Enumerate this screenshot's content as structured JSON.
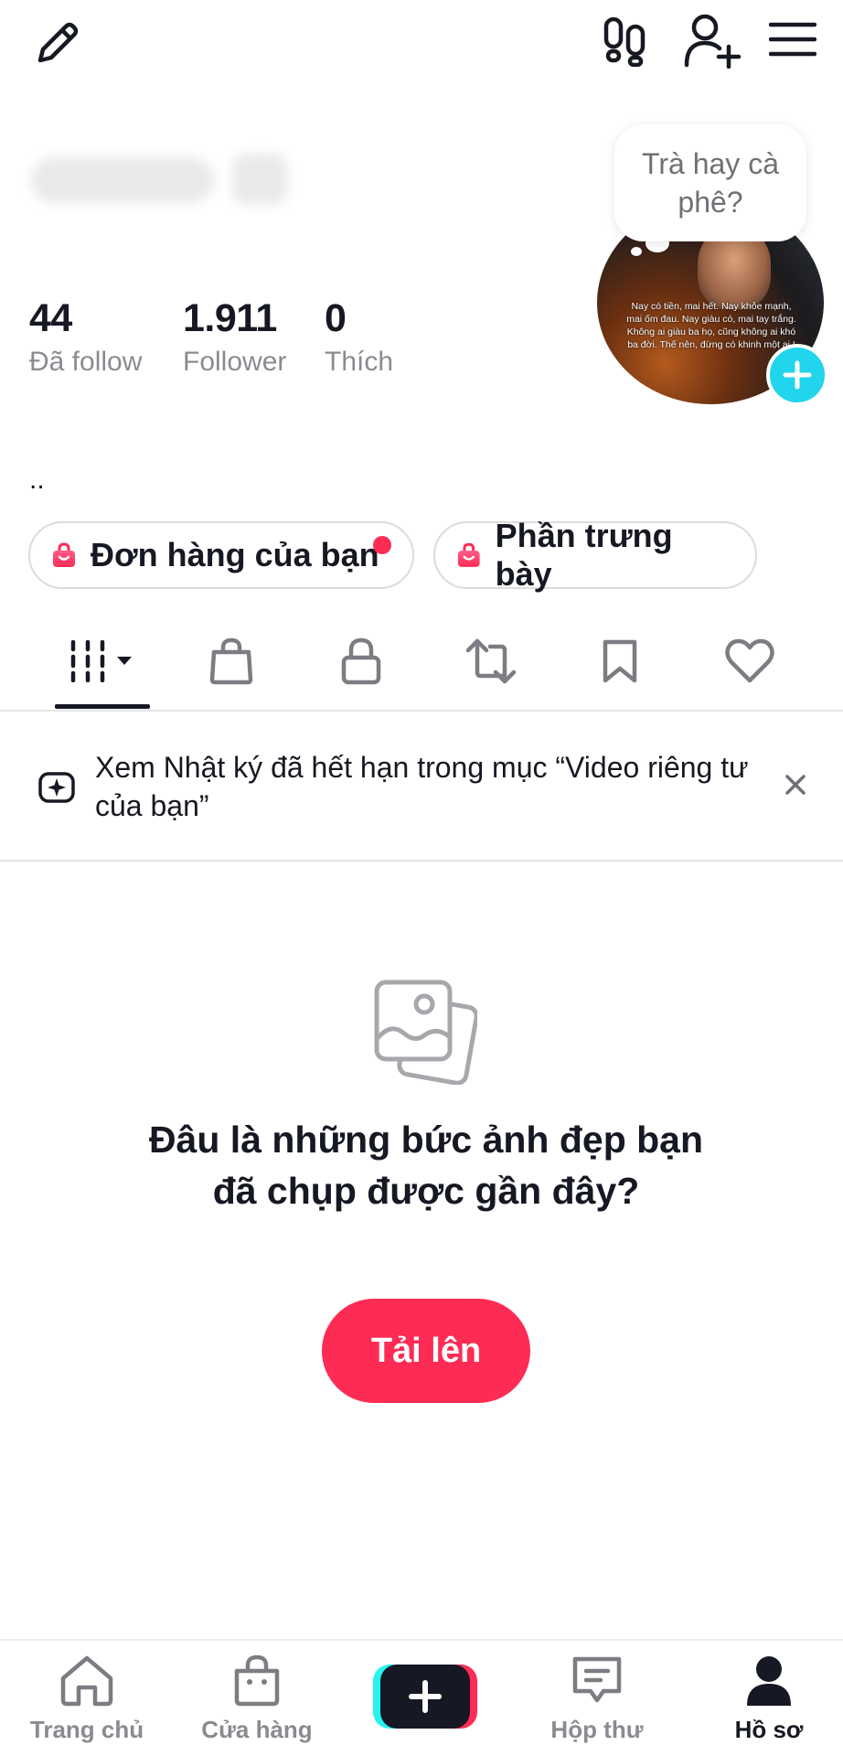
{
  "icons": {
    "edit": "pencil-icon",
    "footprints": "footprints-icon",
    "add_user": "add-user-icon",
    "menu": "hamburger-menu-icon"
  },
  "profile": {
    "bubble_text": "Trà hay cà phê?",
    "avatar_caption": "Nay có tiền, mai hết. Nay khỏe mạnh, mai ốm đau. Nay giàu có, mai tay trắng. Không ai giàu ba họ, cũng không ai khó ba đời. Thế nên, đừng có khinh một ai !",
    "bio": ".."
  },
  "stats": {
    "following": {
      "value": "44",
      "label": "Đã follow"
    },
    "followers": {
      "value": "1.911",
      "label": "Follower"
    },
    "likes": {
      "value": "0",
      "label": "Thích"
    }
  },
  "pills": {
    "orders": {
      "label": "Đơn hàng của bạn",
      "has_notification": true
    },
    "showcase": {
      "label": "Phần trưng bày"
    }
  },
  "tabs": [
    {
      "id": "videos",
      "icon": "grid-icon",
      "active": true
    },
    {
      "id": "shop",
      "icon": "shopping-bag-icon"
    },
    {
      "id": "private",
      "icon": "lock-icon"
    },
    {
      "id": "reposts",
      "icon": "repost-icon"
    },
    {
      "id": "saved",
      "icon": "bookmark-icon"
    },
    {
      "id": "liked",
      "icon": "heart-icon"
    }
  ],
  "notice": {
    "text": "Xem Nhật ký đã hết hạn trong mục “Video riêng tư của bạn”"
  },
  "empty_state": {
    "title": "Đâu là những bức ảnh đẹp bạn đã chụp được gần đây?",
    "button_label": "Tải lên"
  },
  "bottom_nav": {
    "home": "Trang chủ",
    "shop": "Cửa hàng",
    "inbox": "Hộp thư",
    "profile": "Hồ sơ"
  },
  "colors": {
    "accent": "#fe2c55",
    "cyan": "#20d5ec",
    "text_primary": "#161823",
    "text_secondary": "#8a8b91"
  }
}
